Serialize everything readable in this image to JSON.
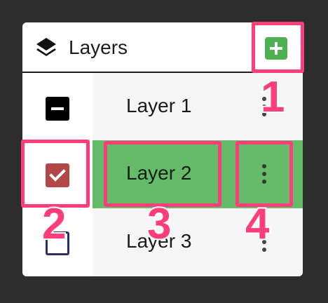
{
  "panel": {
    "title": "Layers",
    "header_icon": "layers-icon",
    "add_icon": "plus-icon"
  },
  "layers": [
    {
      "label": "Layer 1",
      "checkbox_state": "indeterminate",
      "selected": false,
      "menu_icon": "more-vertical-icon"
    },
    {
      "label": "Layer 2",
      "checkbox_state": "checked",
      "selected": true,
      "menu_icon": "more-vertical-icon"
    },
    {
      "label": "Layer 3",
      "checkbox_state": "unchecked",
      "selected": false,
      "menu_icon": "more-vertical-icon"
    }
  ],
  "callouts": [
    {
      "number": "1"
    },
    {
      "number": "2"
    },
    {
      "number": "3"
    },
    {
      "number": "4"
    }
  ],
  "colors": {
    "background": "#2d2d2d",
    "panel": "#ffffff",
    "accent_green": "#4caf50",
    "selected_row": "#66bb6a",
    "checked_box": "#b34747",
    "unchecked_border": "#2c2f6b",
    "callout": "#ff3d7a"
  }
}
